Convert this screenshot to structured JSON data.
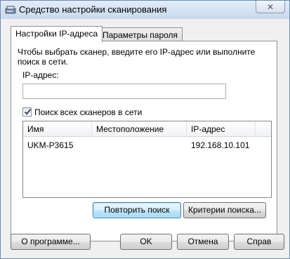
{
  "window": {
    "title": "Средство настройки сканирования",
    "close_symbol": "✕"
  },
  "tabs": [
    {
      "label": "Настройки IP-адреса",
      "active": true
    },
    {
      "label": "Параметры пароля",
      "active": false
    }
  ],
  "ip_tab": {
    "hint": "Чтобы выбрать сканер, введите его IP-адрес или выполните поиск в сети.",
    "ip_label": "IP-адрес:",
    "ip_value": "",
    "search_all_label": "Поиск всех сканеров в сети",
    "search_all_checked": true,
    "list": {
      "columns": [
        "Имя",
        "Местоположение",
        "IP-адрес"
      ],
      "rows": [
        {
          "name": "UKM-P3615",
          "location": "",
          "ip": "192.168.10.101"
        }
      ]
    },
    "retry_button": "Повторить поиск",
    "criteria_button": "Критерии поиска..."
  },
  "footer": {
    "about_button": "О программе...",
    "ok_button": "OK",
    "cancel_button": "Отмена",
    "help_button": "Справ"
  },
  "colors": {
    "accent": "#3c7fb1",
    "titlebar": "#c8d9ee"
  },
  "icons": {
    "app": "scanner-app-icon",
    "close": "close-icon",
    "check": "checkmark-icon"
  }
}
